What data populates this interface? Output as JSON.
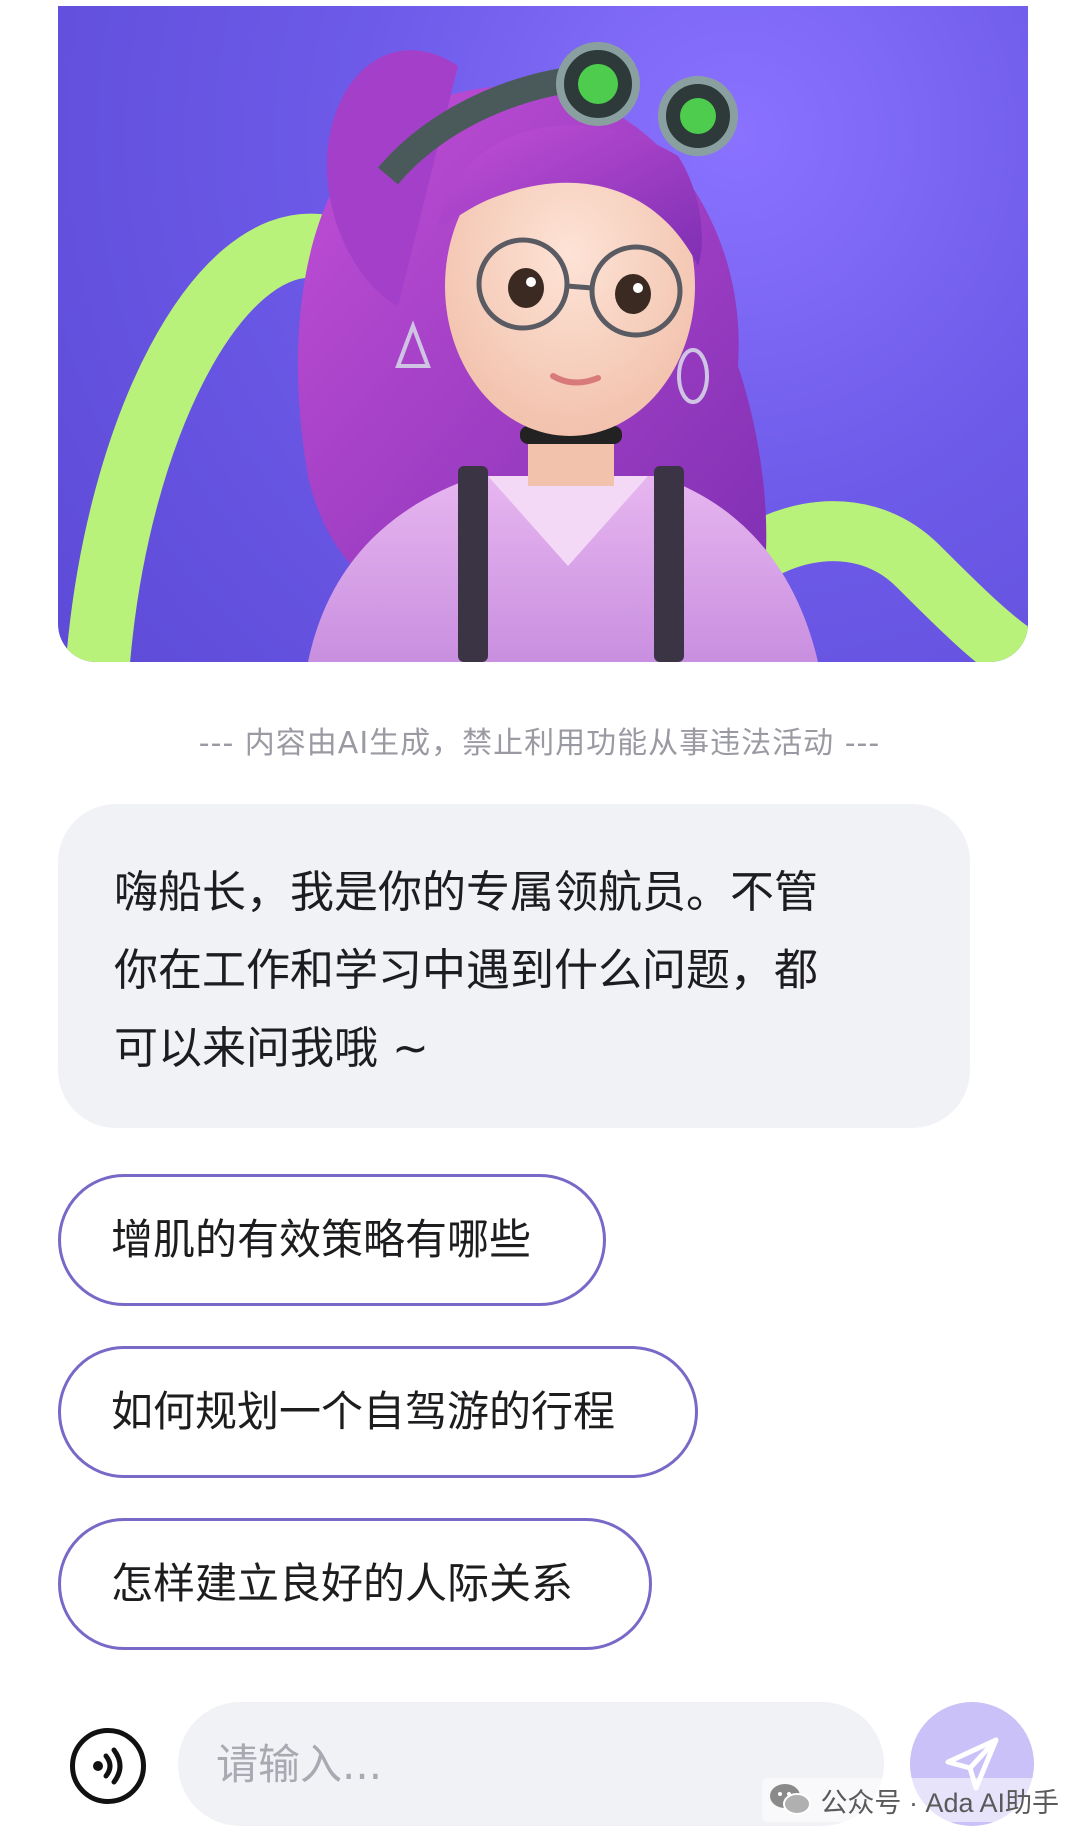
{
  "disclaimer": "--- 内容由AI生成，禁止利用功能从事违法活动 ---",
  "greeting": {
    "line1": "嗨船长，我是你的专属领航员。不管",
    "line2": "你在工作和学习中遇到什么问题，都",
    "line3": "可以来问我哦 ~"
  },
  "suggestions": [
    {
      "label": "增肌的有效策略有哪些"
    },
    {
      "label": "如何规划一个自驾游的行程"
    },
    {
      "label": "怎样建立良好的人际关系"
    }
  ],
  "input": {
    "placeholder": "请输入..."
  },
  "watermark": {
    "text": "公众号 · Ada AI助手"
  },
  "icons": {
    "voice": "voice-wave-icon",
    "send": "send-arrow-icon",
    "wechat": "wechat-icon"
  },
  "colors": {
    "accent": "#7868c8",
    "bubble_bg": "#f1f2f6",
    "send_bg": "#c9c1f7",
    "hero_bg": "#6d5ae8",
    "hero_ribbon": "#b9f27a"
  }
}
